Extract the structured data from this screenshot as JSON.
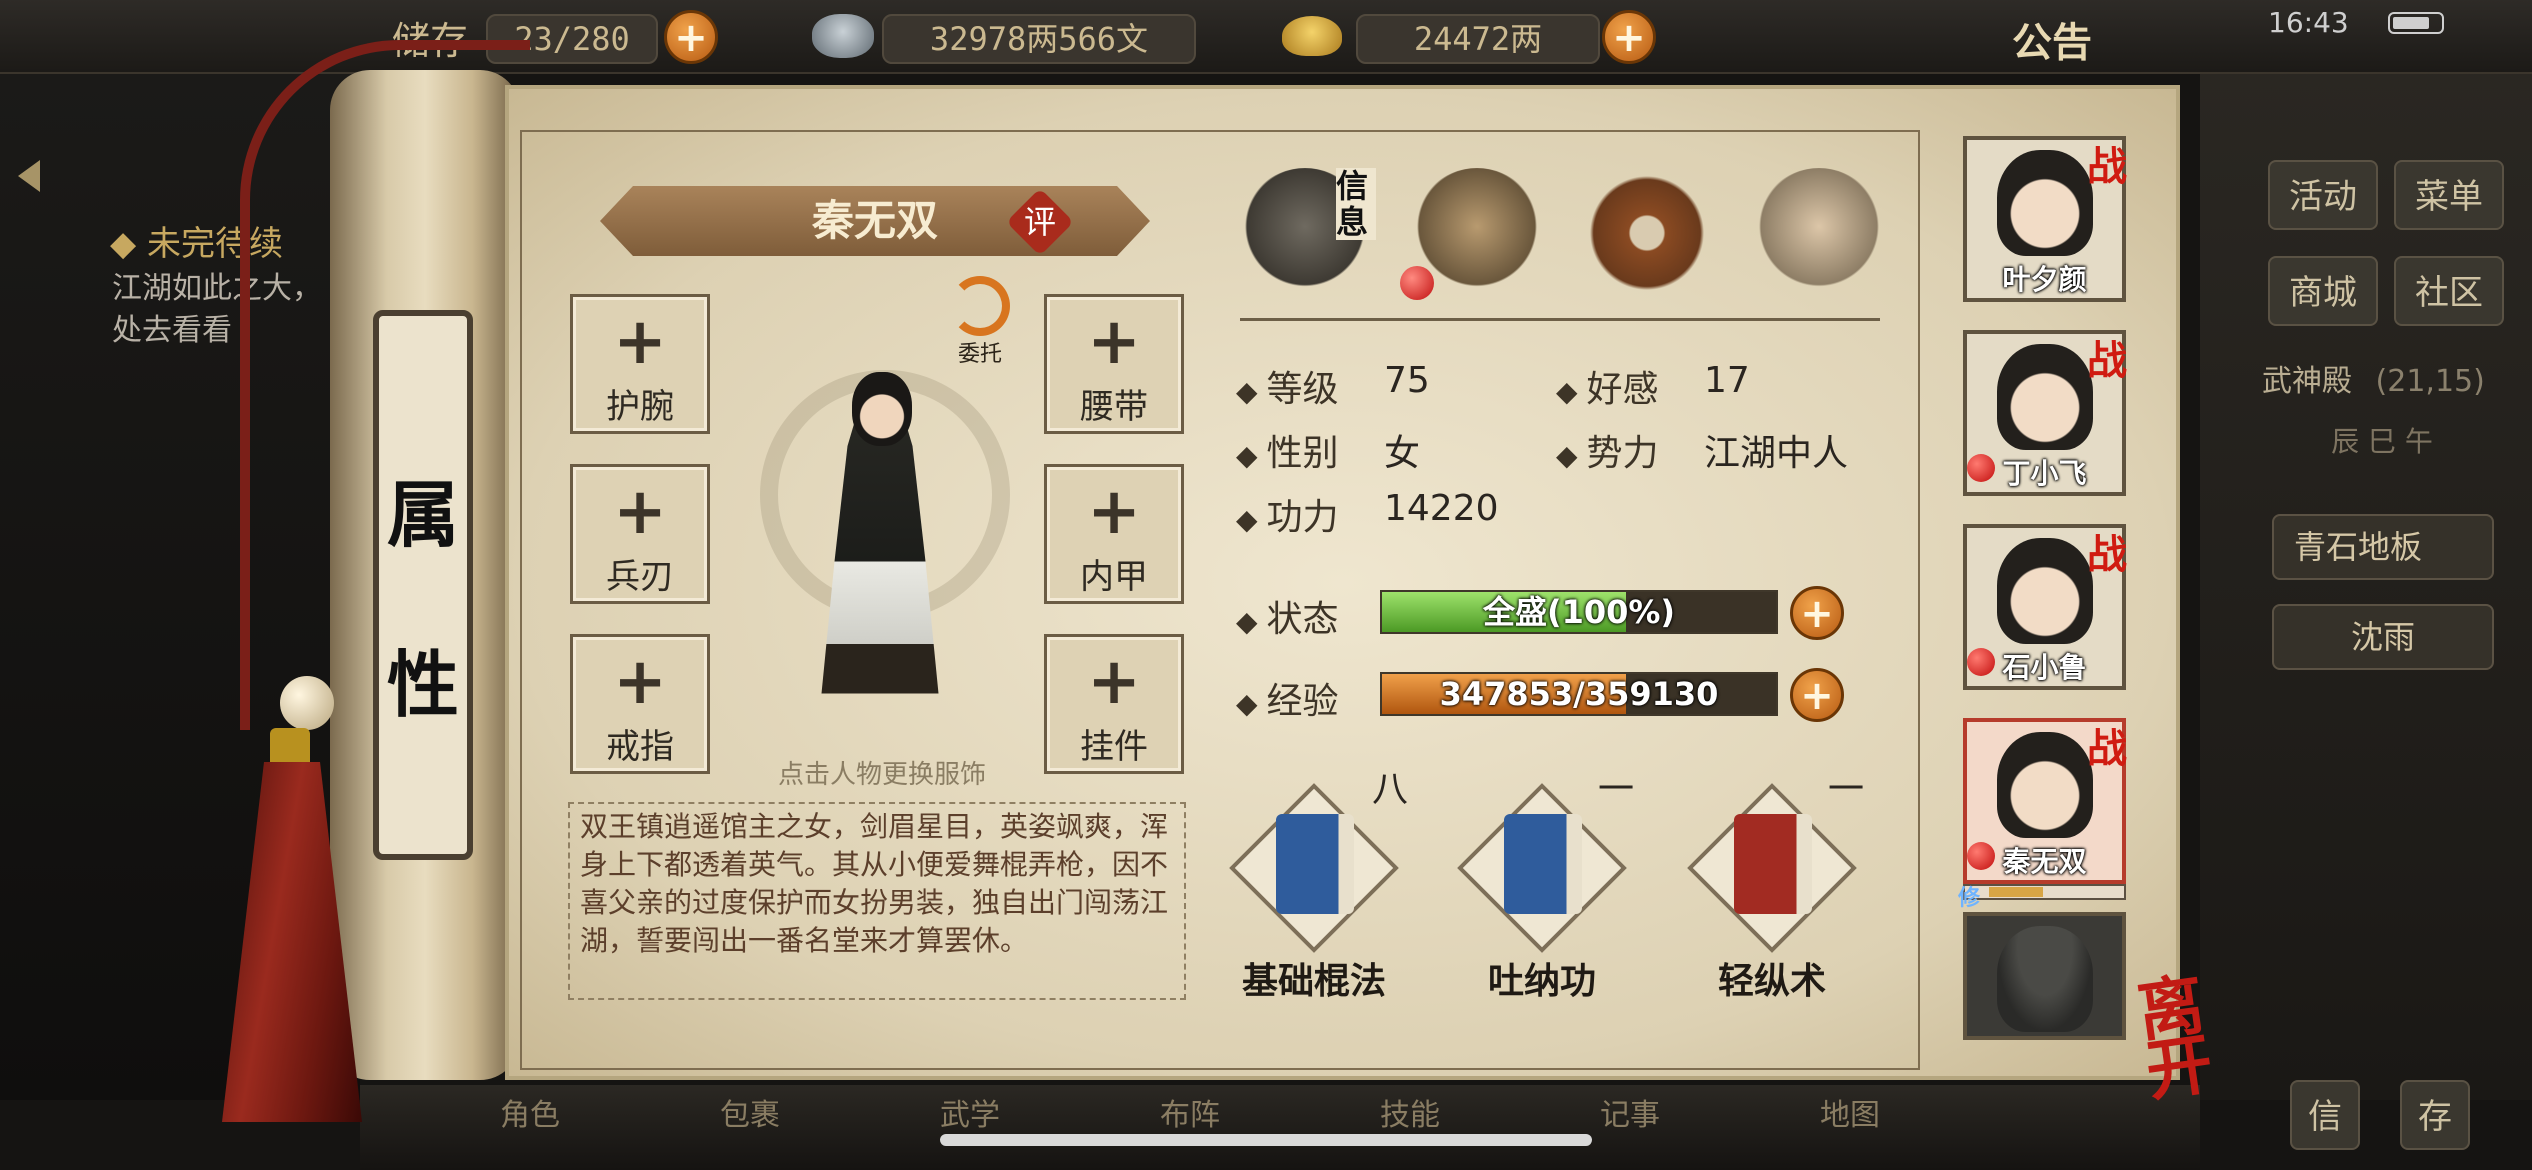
{
  "top_bar": {
    "bag_label": "储存",
    "bag_count": "23/280",
    "silver": "32978两566文",
    "gold": "24472两",
    "notice_label": "公告",
    "time": "16:43"
  },
  "quest": {
    "title": "◆ 未完待续",
    "description": "江湖如此之大，处去看看"
  },
  "side_menu": {
    "activity": "活动",
    "menu": "菜单",
    "shop": "商城",
    "community": "社区",
    "hall_name": "武神殿",
    "hall_coords": "(21,15)",
    "time_band": "辰 巳 午",
    "floor_item": "青石地板",
    "npc_item": "沈雨",
    "letter": "信",
    "save": "存"
  },
  "dock": [
    "角色",
    "包裹",
    "武学",
    "布阵",
    "技能",
    "记事",
    "地图"
  ],
  "tab": {
    "label": "属性"
  },
  "character": {
    "name": "秦无双",
    "rate_badge": "评",
    "entrust_label": "委托",
    "change_outfit_hint": "点击人物更换服饰",
    "bio": "双王镇逍遥馆主之女，剑眉星目，英姿飒爽，浑身上下都透着英气。其从小便爱舞棍弄枪，因不喜父亲的过度保护而女扮男装，独自出门闯荡江湖，誓要闯出一番名堂来才算罢休。"
  },
  "equipment": {
    "bracer": "护腕",
    "weapon": "兵刃",
    "ring": "戒指",
    "belt": "腰带",
    "armor": "内甲",
    "pendant": "挂件",
    "plus": "+"
  },
  "info_tabs": {
    "info_label": "信息"
  },
  "stats": {
    "level_key": "等级",
    "level": "75",
    "favor_key": "好感",
    "favor": "17",
    "gender_key": "性别",
    "gender": "女",
    "faction_key": "势力",
    "faction": "江湖中人",
    "power_key": "功力",
    "power": "14220",
    "status_key": "状态",
    "status_text": "全盛(100%)",
    "status_fraction": 1.0,
    "exp_key": "经验",
    "exp_text": "347853/359130",
    "exp_fraction": 0.9686
  },
  "skills": [
    {
      "name": "基础棍法",
      "level": "八",
      "book_color": "#2f5c9c"
    },
    {
      "name": "吐纳功",
      "level": "一",
      "book_color": "#2f5c9c"
    },
    {
      "name": "轻纵术",
      "level": "一",
      "book_color": "#a22b22"
    }
  ],
  "team": [
    {
      "name": "叶夕颜",
      "war": "战"
    },
    {
      "name": "丁小飞",
      "war": "战"
    },
    {
      "name": "石小鲁",
      "war": "战"
    },
    {
      "name": "秦无双",
      "war": "战",
      "tag": "修"
    }
  ],
  "leave_label": "离开",
  "colors": {
    "panel_paper": "#e6dcc2",
    "accent_red": "#c21b14",
    "status_green": "#4c9a25",
    "exp_orange": "#b0560f"
  }
}
